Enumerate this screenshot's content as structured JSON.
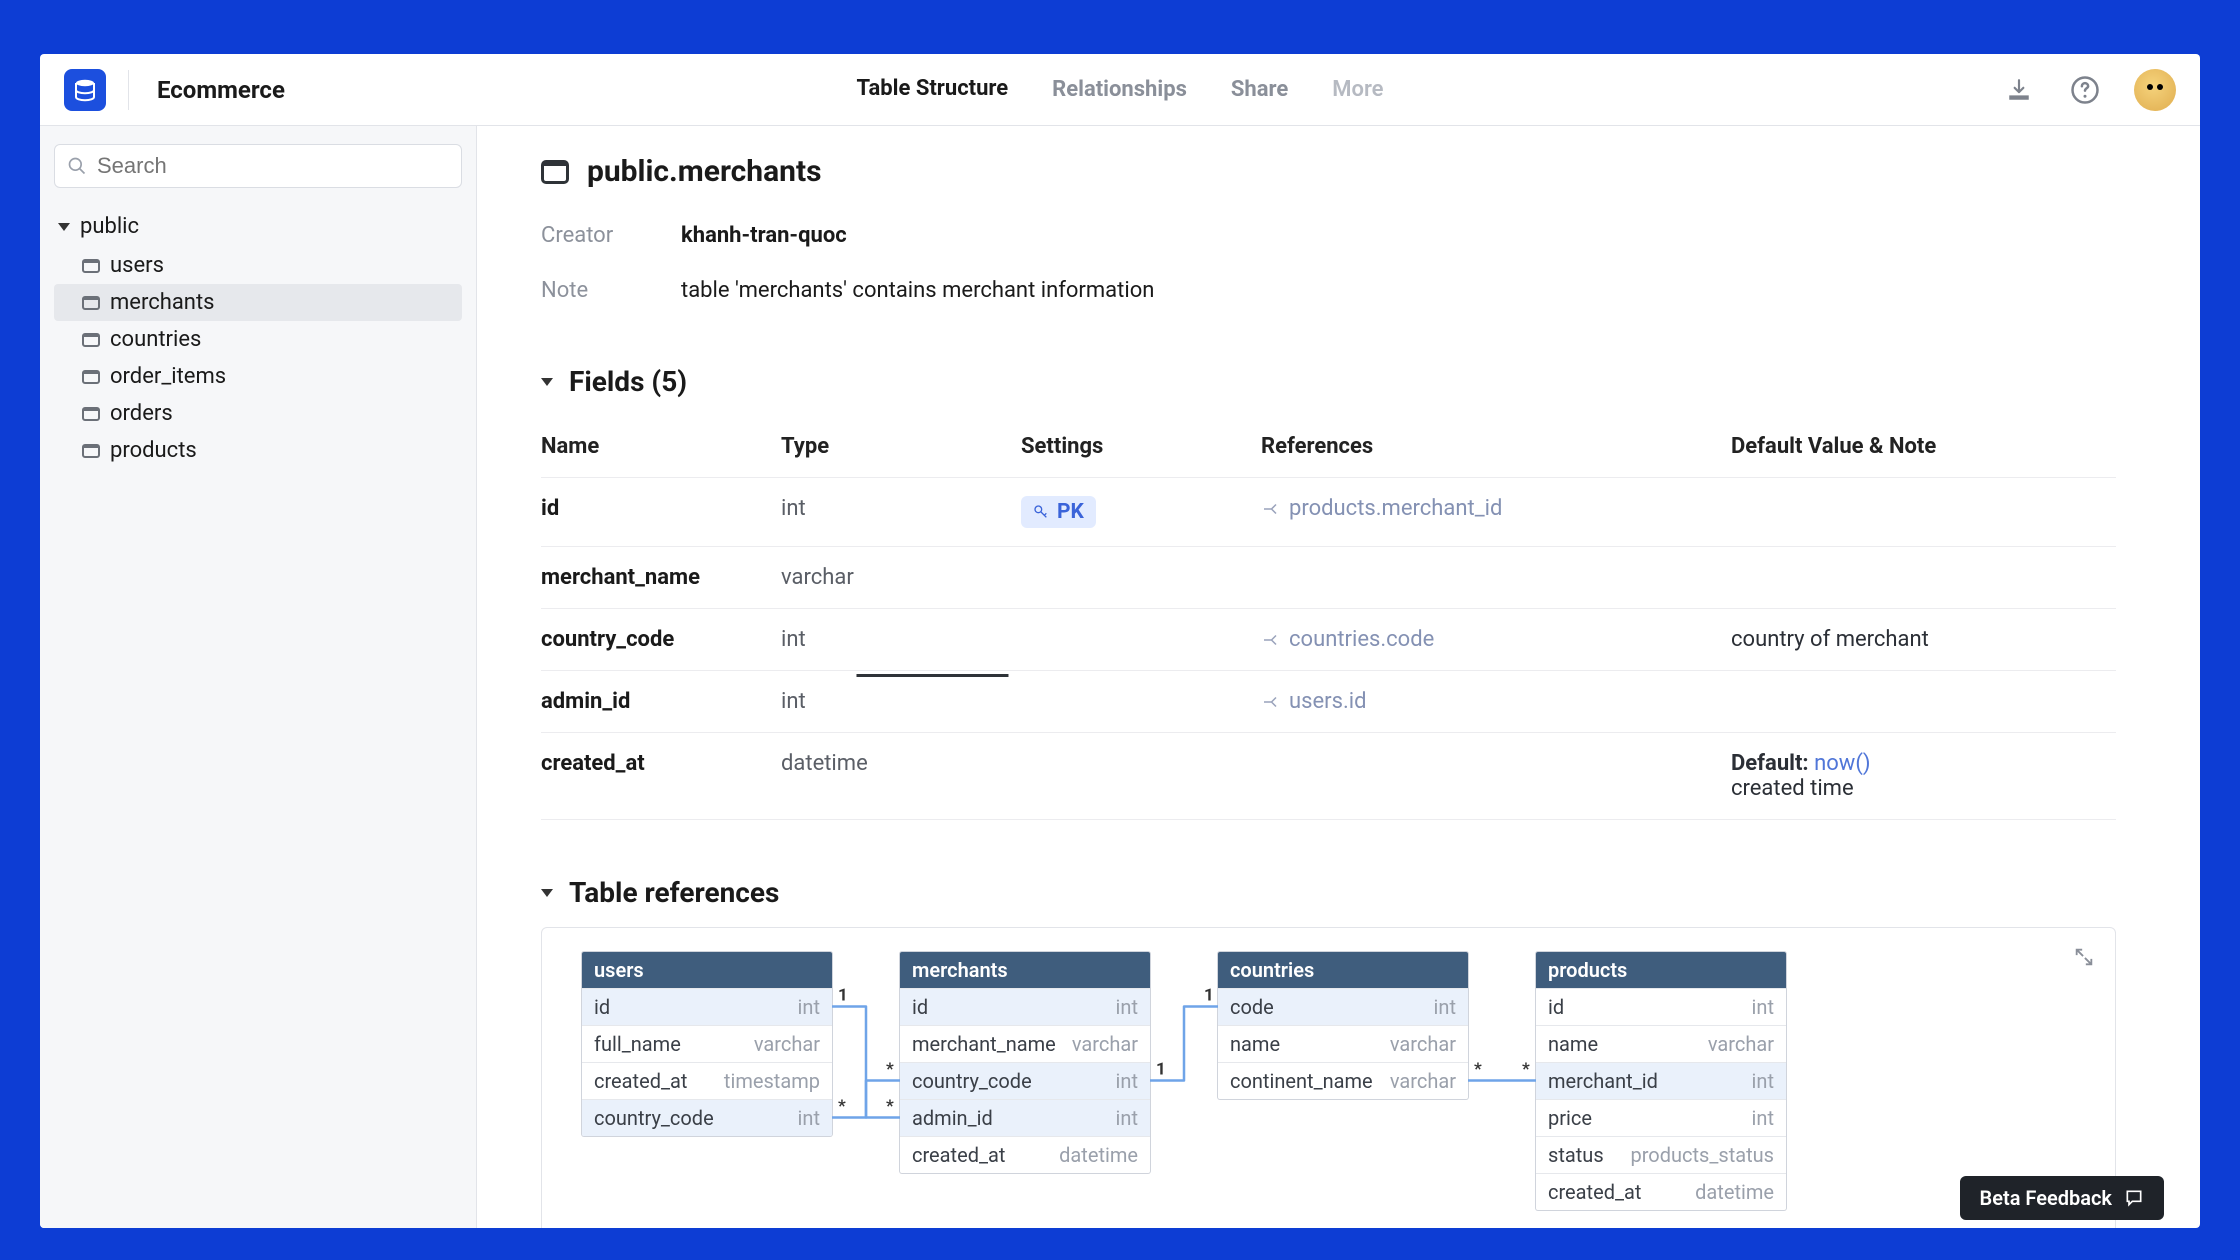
{
  "project": "Ecommerce",
  "tabs": [
    "Table Structure",
    "Relationships",
    "Share",
    "More"
  ],
  "active_tab": 0,
  "search_placeholder": "Search",
  "schema": "public",
  "tables": [
    "users",
    "merchants",
    "countries",
    "order_items",
    "orders",
    "products"
  ],
  "active_table_index": 1,
  "table_title": "public.merchants",
  "meta": {
    "creator_label": "Creator",
    "creator": "khanh-tran-quoc",
    "note_label": "Note",
    "note": "table 'merchants' contains merchant information"
  },
  "fields_header": "Fields (5)",
  "columns": [
    "Name",
    "Type",
    "Settings",
    "References",
    "Default Value & Note"
  ],
  "fields": [
    {
      "name": "id",
      "type": "int",
      "pk": "PK",
      "ref": "products.merchant_id",
      "default": "",
      "note": ""
    },
    {
      "name": "merchant_name",
      "type": "varchar",
      "pk": "",
      "ref": "",
      "default": "",
      "note": ""
    },
    {
      "name": "country_code",
      "type": "int",
      "pk": "",
      "ref": "countries.code",
      "default": "",
      "note": "country of merchant"
    },
    {
      "name": "admin_id",
      "type": "int",
      "pk": "",
      "ref": "users.id",
      "default": "",
      "note": ""
    },
    {
      "name": "created_at",
      "type": "datetime",
      "pk": "",
      "ref": "",
      "default_label": "Default:",
      "default": "now()",
      "note": "created time"
    }
  ],
  "refs_header": "Table references",
  "entities": {
    "users": {
      "title": "users",
      "rows": [
        {
          "n": "id",
          "t": "int",
          "hl": true
        },
        {
          "n": "full_name",
          "t": "varchar"
        },
        {
          "n": "created_at",
          "t": "timestamp"
        },
        {
          "n": "country_code",
          "t": "int",
          "hl": true
        }
      ]
    },
    "merchants": {
      "title": "merchants",
      "rows": [
        {
          "n": "id",
          "t": "int",
          "hl": true
        },
        {
          "n": "merchant_name",
          "t": "varchar"
        },
        {
          "n": "country_code",
          "t": "int",
          "hl": true
        },
        {
          "n": "admin_id",
          "t": "int",
          "hl": true
        },
        {
          "n": "created_at",
          "t": "datetime"
        }
      ]
    },
    "countries": {
      "title": "countries",
      "rows": [
        {
          "n": "code",
          "t": "int",
          "hl": true
        },
        {
          "n": "name",
          "t": "varchar"
        },
        {
          "n": "continent_name",
          "t": "varchar"
        }
      ]
    },
    "products": {
      "title": "products",
      "rows": [
        {
          "n": "id",
          "t": "int"
        },
        {
          "n": "name",
          "t": "varchar"
        },
        {
          "n": "merchant_id",
          "t": "int",
          "hl": true
        },
        {
          "n": "price",
          "t": "int"
        },
        {
          "n": "status",
          "t": "products_status"
        },
        {
          "n": "created_at",
          "t": "datetime"
        }
      ]
    }
  },
  "feedback": "Beta Feedback"
}
